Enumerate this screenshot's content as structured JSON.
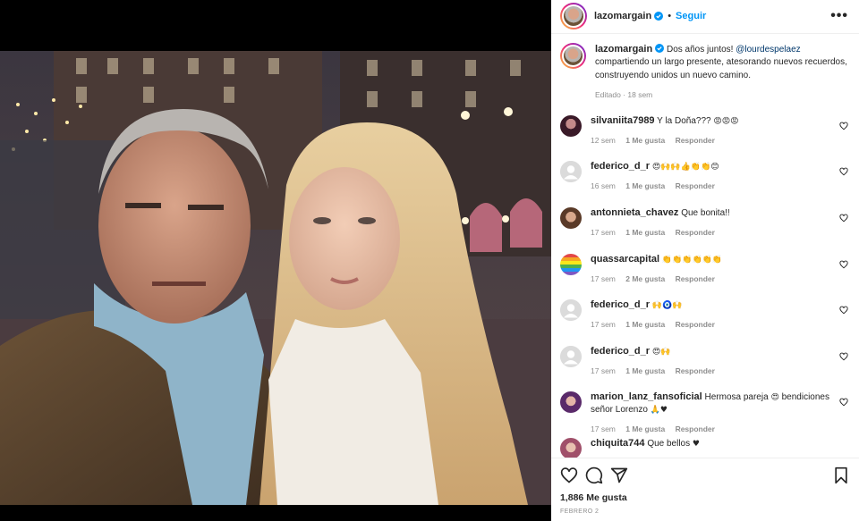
{
  "post": {
    "username": "lazomargain",
    "follow_label": "Seguir",
    "dot": "•",
    "more_label": "•••",
    "caption": {
      "text_before": "Dos años juntos! ",
      "mention": "@lourdespelaez",
      "text_after": " compartiendo un largo presente, atesorando nuevos recuerdos, construyendo unidos un nuevo camino.",
      "meta": "Editado · 18 sem"
    },
    "comments": [
      {
        "user": "silvaniita7989",
        "text": "Y la Doña???",
        "emoji": "😡😡😡",
        "age": "12 sem",
        "likes": "1 Me gusta",
        "reply": "Responder",
        "avatar": "photo-dark"
      },
      {
        "user": "federico_d_r",
        "text": "",
        "emoji": "😍🙌🙌👍👏👏😊",
        "age": "16 sem",
        "likes": "1 Me gusta",
        "reply": "Responder",
        "avatar": "gray"
      },
      {
        "user": "antonnieta_chavez",
        "text": "Que bonita!!",
        "emoji": "",
        "age": "17 sem",
        "likes": "1 Me gusta",
        "reply": "Responder",
        "avatar": "photo-brown"
      },
      {
        "user": "quassarcapital",
        "text": "",
        "emoji": "👏👏👏👏👏👏",
        "age": "17 sem",
        "likes": "2 Me gusta",
        "reply": "Responder",
        "avatar": "rainbow"
      },
      {
        "user": "federico_d_r",
        "text": "",
        "emoji": "🙌🧿🙌",
        "age": "17 sem",
        "likes": "1 Me gusta",
        "reply": "Responder",
        "avatar": "gray"
      },
      {
        "user": "federico_d_r",
        "text": "",
        "emoji": "😍🙌",
        "age": "17 sem",
        "likes": "1 Me gusta",
        "reply": "Responder",
        "avatar": "gray"
      },
      {
        "user": "marion_lanz_fansoficial",
        "text": "Hermosa pareja",
        "emoji": "😍",
        "text2": " bendiciones señor Lorenzo ",
        "emoji2": "🙏♥",
        "age": "17 sem",
        "likes": "1 Me gusta",
        "reply": "Responder",
        "avatar": "photo-purple"
      },
      {
        "user": "chiquita744",
        "text": "Que bellos",
        "emoji": "♥",
        "age": "",
        "likes": "",
        "reply": "",
        "avatar": "photo-pink"
      }
    ],
    "likes_count": "1,886 Me gusta",
    "date": "FEBRERO 2",
    "icons": {
      "like": "heart-icon",
      "comment": "comment-icon",
      "share": "share-icon",
      "save": "bookmark-icon",
      "verified": "verified-badge-icon",
      "more": "more-options-icon"
    },
    "colors": {
      "link": "#0095f6",
      "mention": "#00376b",
      "muted": "#8e8e8e",
      "text": "#262626",
      "verified": "#0095f6"
    }
  }
}
